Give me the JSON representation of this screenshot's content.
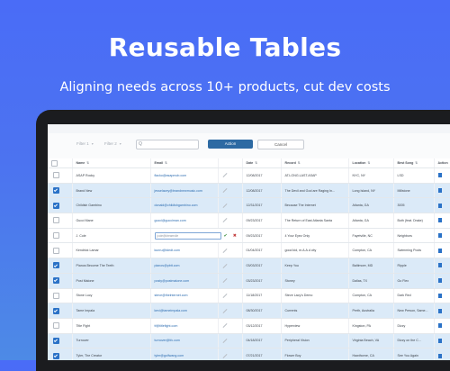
{
  "hero": {
    "title": "Reusable Tables",
    "subtitle": "Aligning needs across 10+ products, cut dev costs"
  },
  "toolbar": {
    "filter1_label": "Filter 1",
    "filter2_label": "Filter 2",
    "search_value": "Q",
    "action_label": "Action",
    "cancel_label": "Cancel"
  },
  "table": {
    "columns": {
      "name": "Name",
      "email": "Email",
      "date": "Date",
      "record": "Record",
      "location": "Location",
      "best_song": "Best Song",
      "actions": "Action"
    },
    "rows": [
      {
        "selected": false,
        "name": "ASAP Rocky",
        "email": "flacko@asapmob.com",
        "date": "12/08/2017",
        "record": "AT.LONG.LAST.ASAP",
        "location": "NYC, NY",
        "song": "LSD"
      },
      {
        "selected": true,
        "name": "Brand New",
        "email": "jesselacey@brandnewmusic.com",
        "date": "12/08/2017",
        "record": "The Devil and God are Raging In...",
        "location": "Long Island, NY",
        "song": "Millstone"
      },
      {
        "selected": true,
        "name": "Childish Gambino",
        "email": "donald@childishgambino.com",
        "date": "12/31/2017",
        "record": "Because The Internet",
        "location": "Atlanta, GA",
        "song": "3005"
      },
      {
        "selected": false,
        "name": "Gucci Mane",
        "email": "gucci@gucciman.com",
        "date": "09/23/2017",
        "record": "The Return of East Atlanta Santa",
        "location": "Atlanta, GA",
        "song": "Both (feat. Drake)"
      },
      {
        "selected": false,
        "name": "J. Cole",
        "editing": true,
        "email_placeholder": "jcole@dreamvile",
        "date": "09/23/2017",
        "record": "4 Your Eyez Only",
        "location": "Fayetville, NC",
        "song": "Neighbors"
      },
      {
        "selected": false,
        "name": "Kendrick Lamar",
        "email": "kunru@tdedt.com",
        "date": "01/04/2017",
        "record": "good kid, m.A.A.d city",
        "location": "Compton, CA",
        "song": "Swimming Pools"
      },
      {
        "selected": true,
        "name": "Pianos Become The Teeth",
        "email": "pianos@pbtt.com",
        "date": "03/03/2017",
        "record": "Keep You",
        "location": "Baltimore, MD",
        "song": "Ripple"
      },
      {
        "selected": true,
        "name": "Post Malone",
        "email": "posty@postmalone.com",
        "date": "03/23/2017",
        "record": "Stoney",
        "location": "Dallas, TX",
        "song": "Go Flex"
      },
      {
        "selected": false,
        "name": "Stone Lucy",
        "email": "steve@thelnternet.com",
        "date": "11/18/2017",
        "record": "Steve Lacy's Demo",
        "location": "Compton, CA",
        "song": "Dark Red"
      },
      {
        "selected": true,
        "name": "Tame Impala",
        "email": "kevi@tameimpala.com",
        "date": "08/30/2017",
        "record": "Currents",
        "location": "Perth, Australia",
        "song": "New Person, Same..."
      },
      {
        "selected": false,
        "name": "Title Fight",
        "email": "tf@titlefight.com",
        "date": "03/12/2017",
        "record": "Hyperview",
        "location": "Kingston, PA",
        "song": "Dizzy"
      },
      {
        "selected": true,
        "name": "Turnover",
        "email": "turnover@tfc.com",
        "date": "04/18/2017",
        "record": "Peripheral Vision",
        "location": "Virginia Beach, VA",
        "song": "Dizzy on the C..."
      },
      {
        "selected": true,
        "name": "Tyler, The Creator",
        "email": "tyler@golfwang.com",
        "date": "07/21/2017",
        "record": "Flower Boy",
        "location": "Hawthorne, CA",
        "song": "See You Again"
      }
    ]
  }
}
